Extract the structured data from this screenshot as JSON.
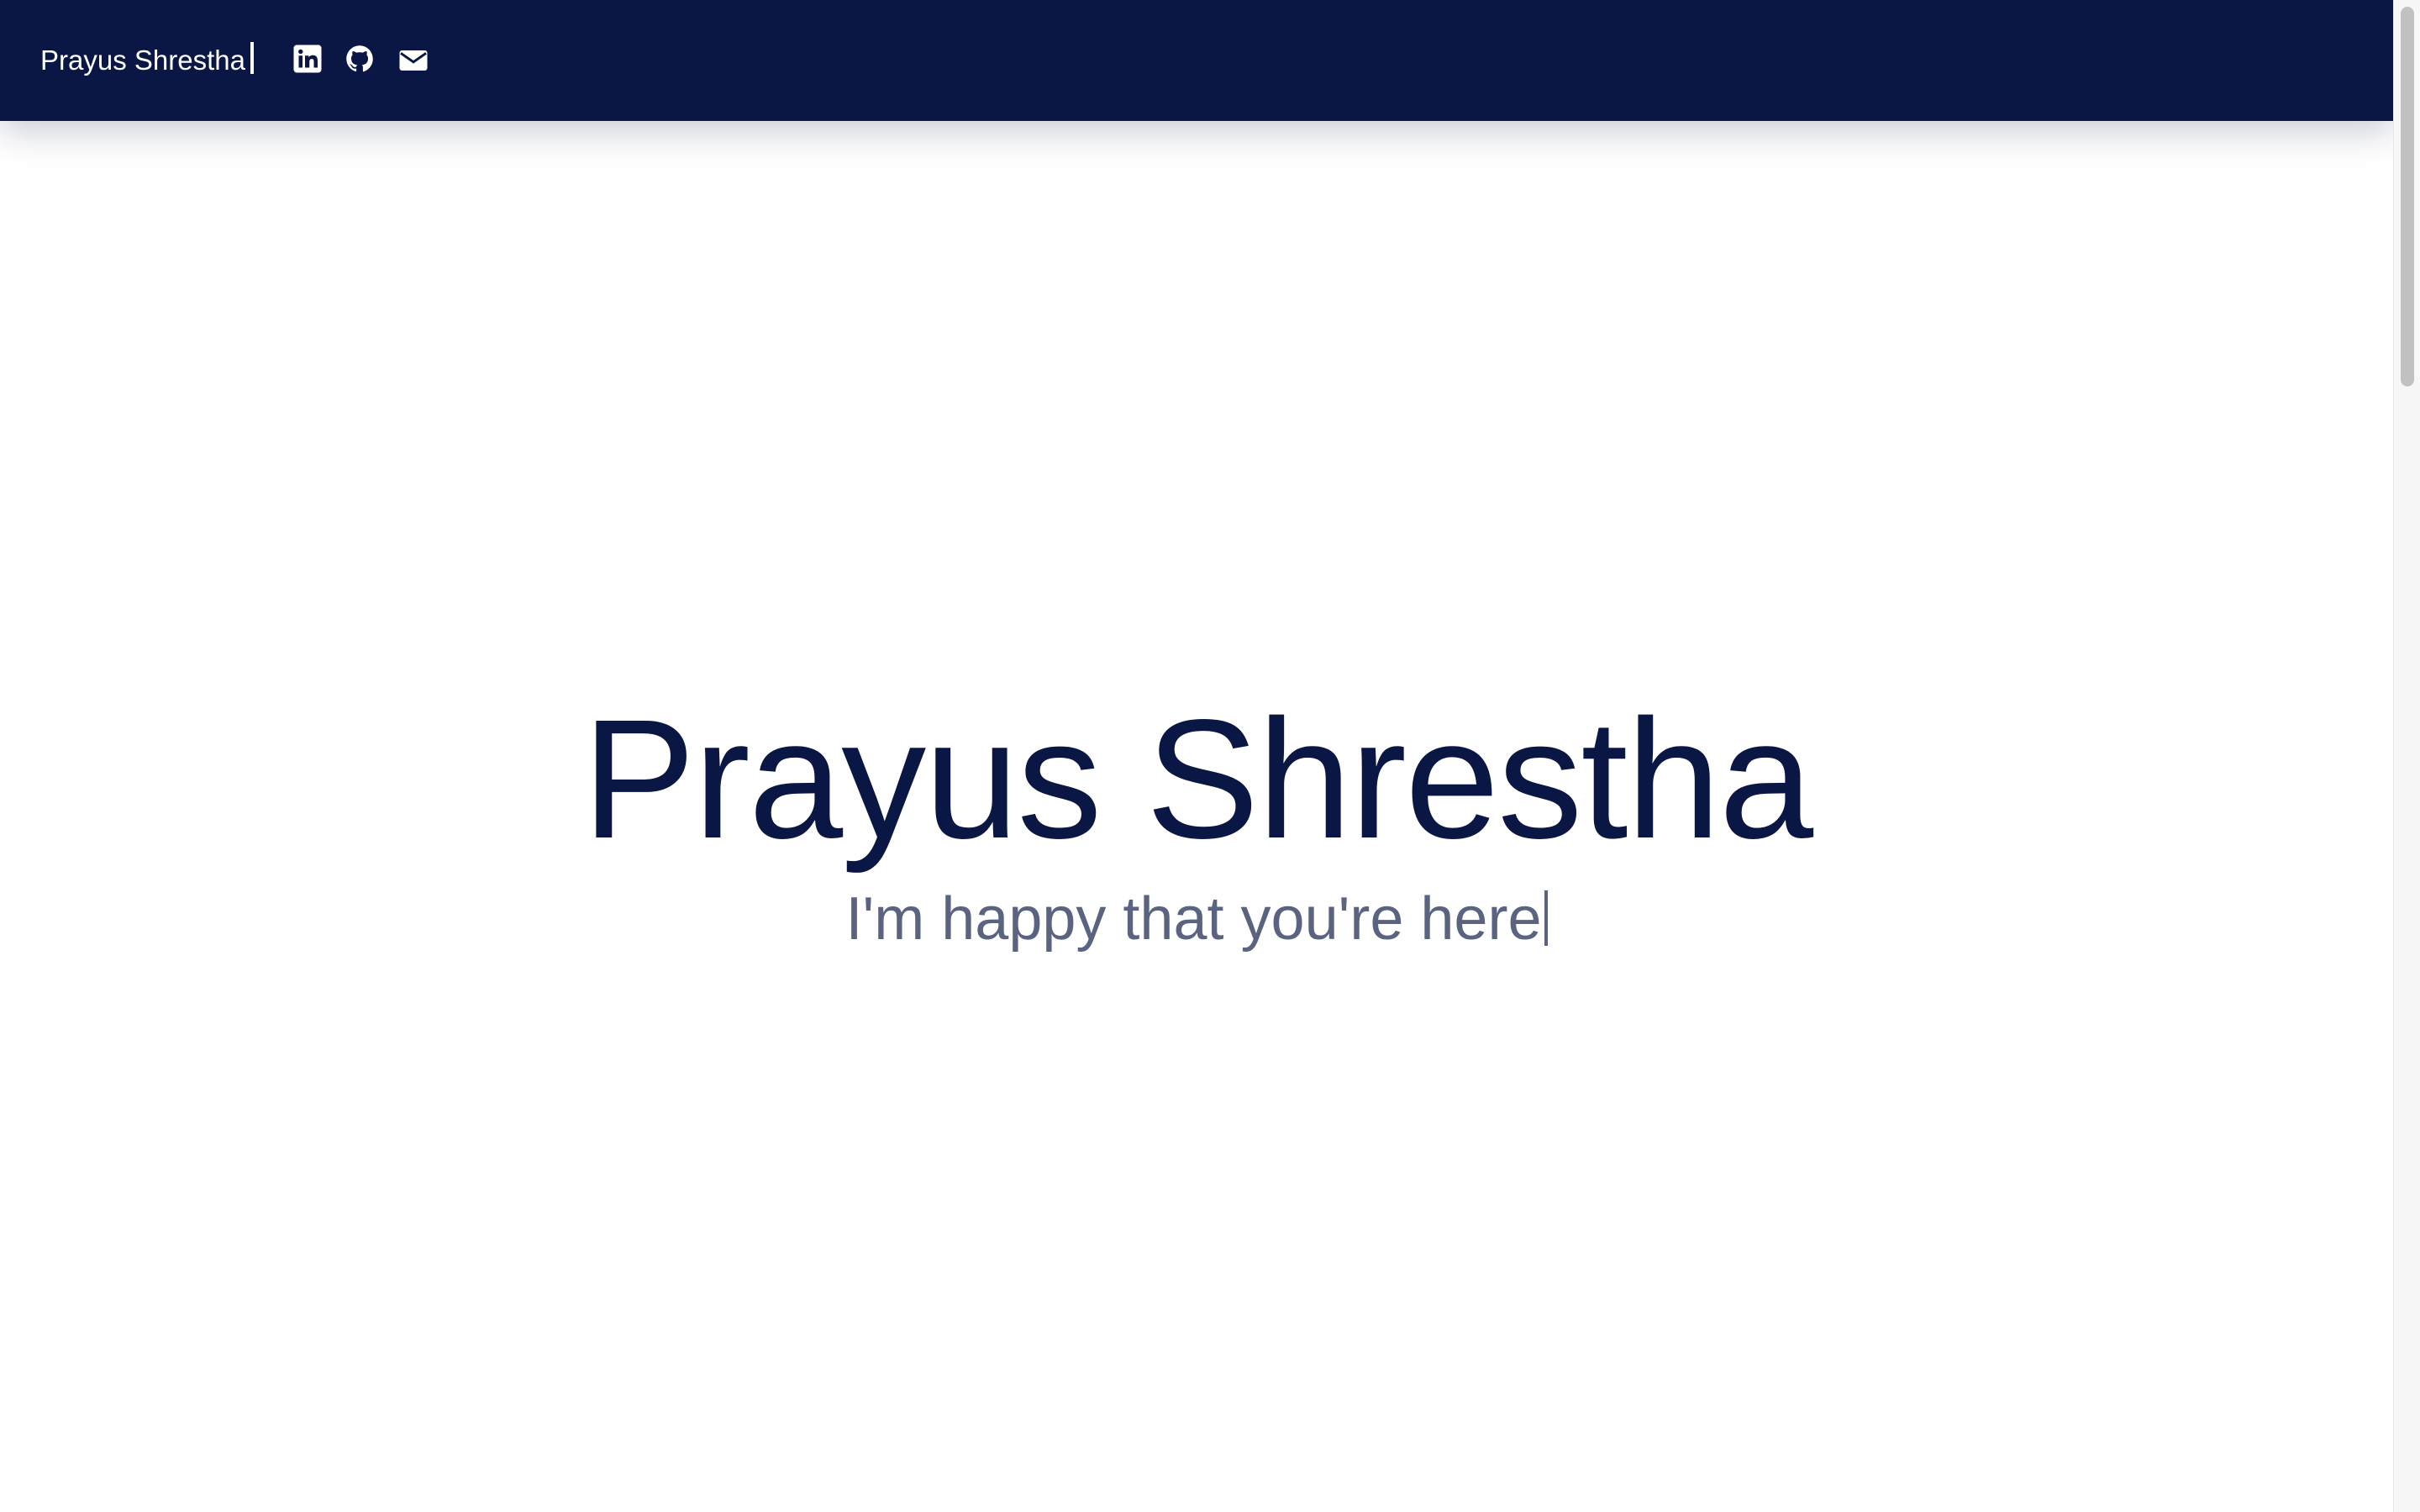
{
  "navbar": {
    "brand": "Prayus Shrestha",
    "icons": [
      "linkedin-icon",
      "github-icon",
      "email-icon"
    ],
    "background_color": "#0a1744"
  },
  "hero": {
    "name": "Prayus Shrestha",
    "tagline": "I'm happy that you're here",
    "name_color": "#0a1744",
    "tagline_color": "#5a6380"
  }
}
